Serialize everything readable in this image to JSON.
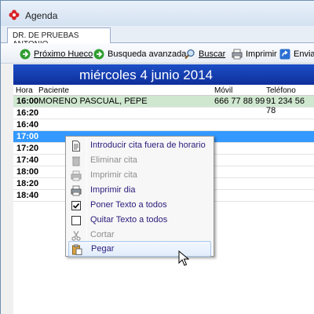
{
  "window": {
    "title": "Agenda"
  },
  "tabs": [
    {
      "label": "DR. DE PRUEBAS ANTONIO"
    }
  ],
  "toolbar": {
    "buttons": [
      {
        "label": "Próximo Hueco",
        "icon": "green-arrow-icon"
      },
      {
        "label": "Busqueda avanzada",
        "icon": "green-arrow-icon"
      },
      {
        "label": "Buscar",
        "icon": "magnifier-icon"
      },
      {
        "label": "Imprimir",
        "icon": "printer-icon"
      },
      {
        "label": "Enviar",
        "icon": "send-icon"
      }
    ]
  },
  "day": {
    "title": "miércoles 4 junio 2014"
  },
  "columns": {
    "hora": "Hora",
    "paciente": "Paciente",
    "movil": "Móvil",
    "telefono": "Teléfono"
  },
  "rows": [
    {
      "time": "16:00",
      "patient": "MORENO PASCUAL, PEPE",
      "mobile": "666 77 88 99",
      "phone": "91 234 56 78",
      "state": "booked"
    },
    {
      "time": "16:20",
      "patient": "",
      "mobile": "",
      "phone": "",
      "state": "free"
    },
    {
      "time": "16:40",
      "patient": "",
      "mobile": "",
      "phone": "",
      "state": "free"
    },
    {
      "time": "17:00",
      "patient": "",
      "mobile": "",
      "phone": "",
      "state": "selected"
    },
    {
      "time": "17:20",
      "patient": "",
      "mobile": "",
      "phone": "",
      "state": "free"
    },
    {
      "time": "17:40",
      "patient": "",
      "mobile": "",
      "phone": "",
      "state": "free"
    },
    {
      "time": "18:00",
      "patient": "",
      "mobile": "",
      "phone": "",
      "state": "free"
    },
    {
      "time": "18:20",
      "patient": "",
      "mobile": "",
      "phone": "",
      "state": "free"
    },
    {
      "time": "18:40",
      "patient": "",
      "mobile": "",
      "phone": "",
      "state": "free"
    }
  ],
  "context_menu": {
    "items": [
      {
        "label": "Introducir cita fuera de horario",
        "icon": "document-icon",
        "enabled": true
      },
      {
        "label": "Eliminar cita",
        "icon": "trash-icon",
        "enabled": false
      },
      {
        "label": "Imprimir cita",
        "icon": "printer-icon",
        "enabled": false
      },
      {
        "label": "Imprimir dia",
        "icon": "printer-icon",
        "enabled": true
      },
      {
        "label": "Poner Texto a todos",
        "icon": "checkbox-checked-icon",
        "enabled": true
      },
      {
        "label": "Quitar Texto a todos",
        "icon": "checkbox-empty-icon",
        "enabled": true
      },
      {
        "label": "Cortar",
        "icon": "scissors-icon",
        "enabled": false
      },
      {
        "label": "Pegar",
        "icon": "clipboard-icon",
        "enabled": true,
        "highlighted": true
      }
    ]
  },
  "colors": {
    "day_header": "#1c4fc7",
    "booked_row": "#cfe7cf",
    "selected_row": "#3399ff"
  }
}
